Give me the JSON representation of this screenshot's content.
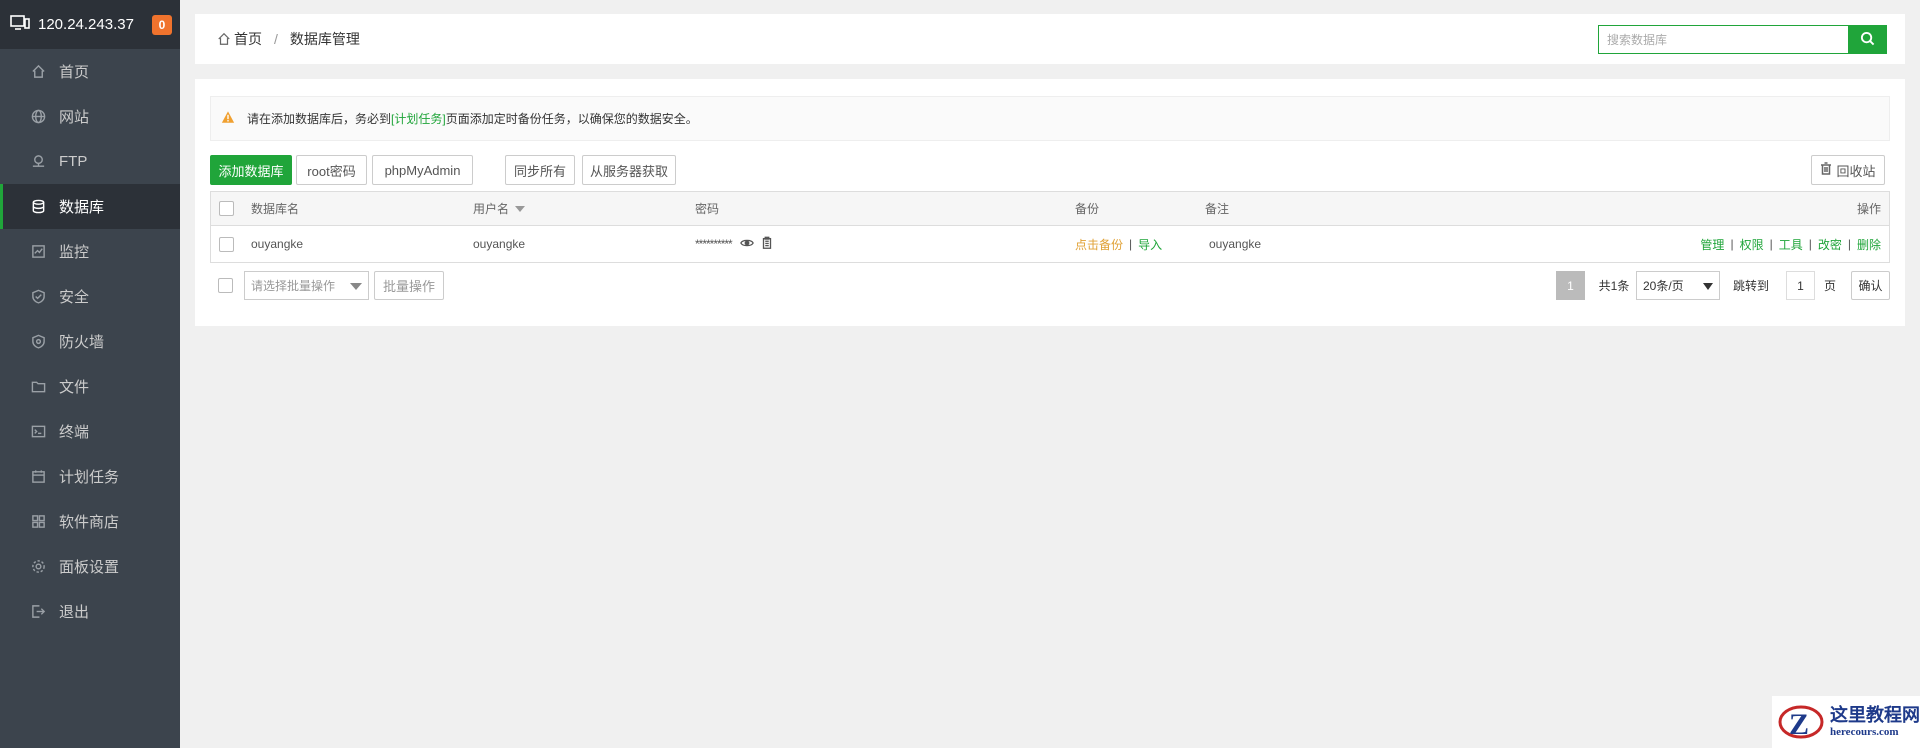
{
  "sidebar": {
    "server_ip": "120.24.243.37",
    "badge_count": "0",
    "items": [
      {
        "label": "首页",
        "icon": "home-icon"
      },
      {
        "label": "网站",
        "icon": "globe-icon"
      },
      {
        "label": "FTP",
        "icon": "ftp-icon"
      },
      {
        "label": "数据库",
        "icon": "database-icon",
        "active": true
      },
      {
        "label": "监控",
        "icon": "monitor-icon"
      },
      {
        "label": "安全",
        "icon": "shield-icon"
      },
      {
        "label": "防火墙",
        "icon": "firewall-icon"
      },
      {
        "label": "文件",
        "icon": "folder-icon"
      },
      {
        "label": "终端",
        "icon": "terminal-icon"
      },
      {
        "label": "计划任务",
        "icon": "calendar-icon"
      },
      {
        "label": "软件商店",
        "icon": "apps-icon"
      },
      {
        "label": "面板设置",
        "icon": "gear-icon"
      },
      {
        "label": "退出",
        "icon": "logout-icon"
      }
    ]
  },
  "breadcrumb": {
    "home": "首页",
    "separator": "/",
    "current": "数据库管理"
  },
  "search": {
    "placeholder": "搜索数据库"
  },
  "notice": {
    "prefix": "请在添加数据库后，务必到",
    "link": "[计划任务]",
    "suffix": "页面添加定时备份任务，以确保您的数据安全。"
  },
  "toolbar": {
    "add_db": "添加数据库",
    "root_pw": "root密码",
    "phpmyadmin": "phpMyAdmin",
    "sync_all": "同步所有",
    "fetch_server": "从服务器获取",
    "recycle": "回收站"
  },
  "table": {
    "headers": {
      "name": "数据库名",
      "user": "用户名",
      "password": "密码",
      "backup": "备份",
      "note": "备注",
      "actions": "操作"
    },
    "rows": [
      {
        "name": "ouyangke",
        "user": "ouyangke",
        "password": "**********",
        "backup_link": "点击备份",
        "import_link": "导入",
        "note": "ouyangke",
        "actions": [
          "管理",
          "权限",
          "工具",
          "改密",
          "删除"
        ]
      }
    ]
  },
  "footer": {
    "batch_placeholder": "请选择批量操作",
    "batch_button": "批量操作",
    "current_page": "1",
    "total": "共1条",
    "per_page": "20条/页",
    "jump_label": "跳转到",
    "jump_value": "1",
    "page_unit": "页",
    "confirm": "确认"
  },
  "watermark": {
    "title": "这里教程网",
    "url": "herecours.com"
  },
  "colors": {
    "accent": "#20a53a",
    "sidebar_bg": "#3c444d",
    "sidebar_dark": "#2c3138",
    "badge": "#f0732d",
    "warning": "#e0a135"
  }
}
